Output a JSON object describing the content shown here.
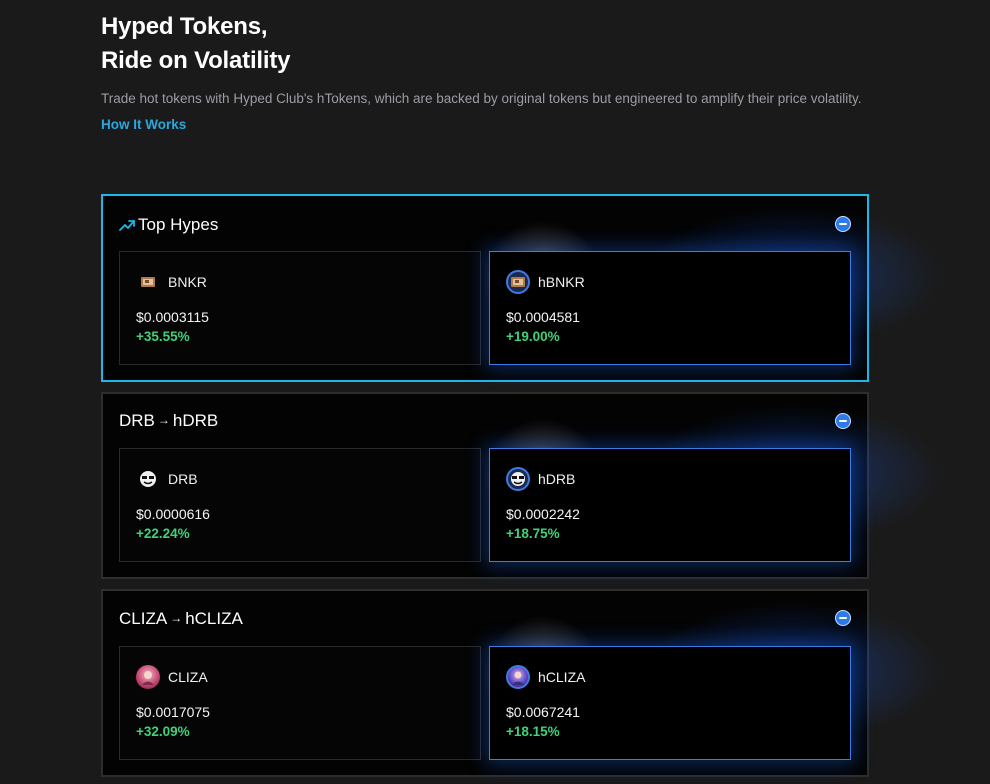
{
  "hero": {
    "title_line1": "Hyped Tokens,",
    "title_line2": "Ride on Volatility",
    "subtitle": "Trade hot tokens with Hyped Club's hTokens, which are backed by original tokens but engineered to amplify their price volatility.",
    "how_link": "How It Works"
  },
  "cards": [
    {
      "header_icon": "trend-up-icon",
      "header_title": "Top Hypes",
      "left": {
        "name": "BNKR",
        "price": "$0.0003115",
        "change": "+35.55%",
        "icon": "bnkr-token-icon"
      },
      "right": {
        "name": "hBNKR",
        "price": "$0.0004581",
        "change": "+19.00%",
        "icon": "hbnkr-token-icon"
      }
    },
    {
      "header_from": "DRB",
      "header_arrow": "→",
      "header_to": "hDRB",
      "left": {
        "name": "DRB",
        "price": "$0.0000616",
        "change": "+22.24%",
        "icon": "drb-token-icon"
      },
      "right": {
        "name": "hDRB",
        "price": "$0.0002242",
        "change": "+18.75%",
        "icon": "hdrb-token-icon"
      }
    },
    {
      "header_from": "CLIZA",
      "header_arrow": "→",
      "header_to": "hCLIZA",
      "left": {
        "name": "CLIZA",
        "price": "$0.0017075",
        "change": "+32.09%",
        "icon": "cliza-token-icon"
      },
      "right": {
        "name": "hCLIZA",
        "price": "$0.0067241",
        "change": "+18.15%",
        "icon": "hcliza-token-icon"
      }
    }
  ],
  "colors": {
    "accent": "#1fb6e8",
    "link": "#2aa8e0",
    "positive": "#3fd27a",
    "htoken_border": "#3f7be0"
  }
}
